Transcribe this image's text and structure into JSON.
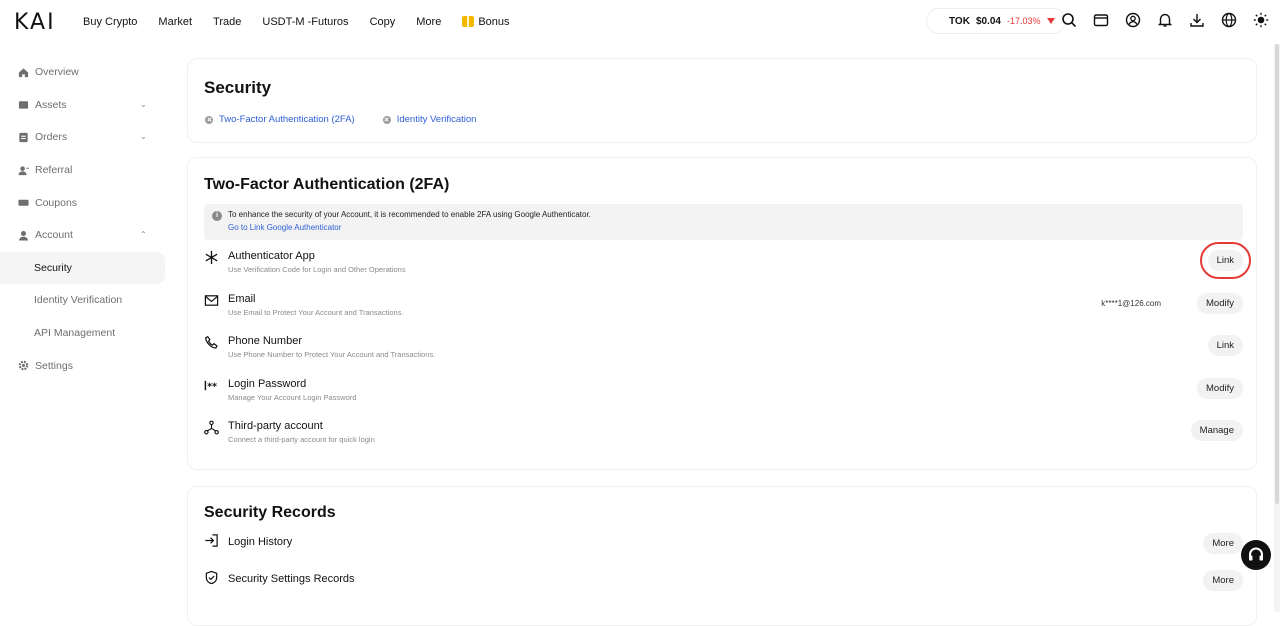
{
  "brand": {
    "logo": "KAI"
  },
  "nav": {
    "items": [
      "Buy Crypto",
      "Market",
      "Trade",
      "USDT-M -Futuros",
      "Copy",
      "More"
    ],
    "bonus": "Bonus"
  },
  "ticker": {
    "symbol": "TOK",
    "price": "$0.04",
    "change": "-17.03%",
    "change_color": "#e53935"
  },
  "top_icons": [
    "search-icon",
    "wallet-icon",
    "user-icon",
    "bell-icon",
    "download-icon",
    "globe-icon",
    "theme-icon"
  ],
  "sidebar": {
    "items": [
      {
        "label": "Overview",
        "icon": "home-icon"
      },
      {
        "label": "Assets",
        "icon": "wallet-icon",
        "chevron": "down"
      },
      {
        "label": "Orders",
        "icon": "orders-icon",
        "chevron": "down"
      },
      {
        "label": "Referral",
        "icon": "referral-icon"
      },
      {
        "label": "Coupons",
        "icon": "coupon-icon"
      },
      {
        "label": "Account",
        "icon": "account-icon",
        "chevron": "up"
      },
      {
        "label": "Security",
        "sub": true,
        "active": true
      },
      {
        "label": "Identity Verification",
        "sub": true
      },
      {
        "label": "API Management",
        "sub": true
      },
      {
        "label": "Settings",
        "icon": "gear-icon"
      }
    ]
  },
  "security": {
    "title": "Security",
    "links": [
      "Two-Factor Authentication (2FA)",
      "Identity Verification"
    ]
  },
  "twofa": {
    "title": "Two-Factor Authentication (2FA)",
    "notice": "To enhance the security of your Account, it is recommended to enable 2FA using Google Authenticator.",
    "notice_link": "Go to Link Google Authenticator",
    "rows": [
      {
        "title": "Authenticator App",
        "desc": "Use Verification Code for Login and Other Operations",
        "value": "",
        "action": "Link"
      },
      {
        "title": "Email",
        "desc": "Use Email to Protect Your Account and Transactions.",
        "value": "k****1@126.com",
        "action": "Modify"
      },
      {
        "title": "Phone Number",
        "desc": "Use Phone Number to Protect Your Account and Transactions.",
        "value": "",
        "action": "Link"
      },
      {
        "title": "Login Password",
        "desc": "Manage Your Account Login Password",
        "value": "",
        "action": "Modify"
      },
      {
        "title": "Third-party account",
        "desc": "Connect a third-party account for quick login",
        "value": "",
        "action": "Manage"
      }
    ]
  },
  "records": {
    "title": "Security Records",
    "rows": [
      {
        "title": "Login History",
        "action": "More"
      },
      {
        "title": "Security Settings Records",
        "action": "More"
      }
    ]
  }
}
